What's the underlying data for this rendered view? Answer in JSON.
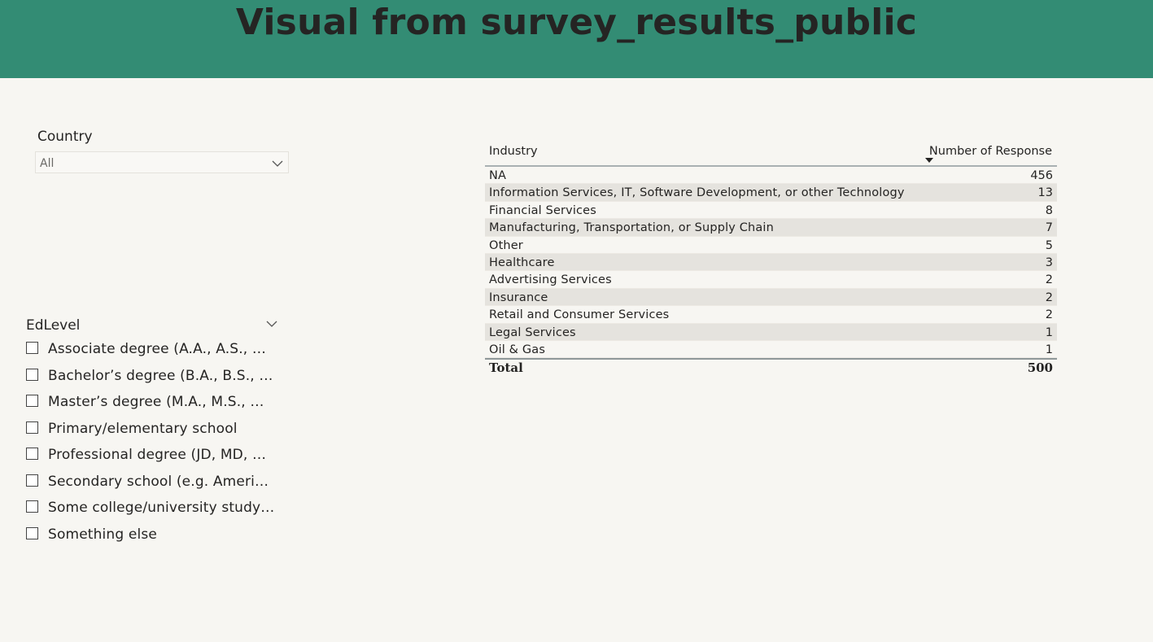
{
  "header": {
    "title": "Visual from survey_results_public",
    "background_color": "#338c74"
  },
  "country_slicer": {
    "title": "Country",
    "selected": "All",
    "chevron_icon": "chevron-down-icon"
  },
  "edlevel_slicer": {
    "title": "EdLevel",
    "chevron_icon": "chevron-down-icon",
    "options": [
      {
        "label": "Associate degree (A.A., A.S., …",
        "checked": false
      },
      {
        "label": "Bachelor’s degree (B.A., B.S., …",
        "checked": false
      },
      {
        "label": "Master’s degree (M.A., M.S., …",
        "checked": false
      },
      {
        "label": "Primary/elementary school",
        "checked": false
      },
      {
        "label": "Professional degree (JD, MD, …",
        "checked": false
      },
      {
        "label": "Secondary school (e.g. Ameri…",
        "checked": false
      },
      {
        "label": "Some college/university study…",
        "checked": false
      },
      {
        "label": "Something else",
        "checked": false
      }
    ]
  },
  "industry_table": {
    "columns": {
      "industry": "Industry",
      "count": "Number of Response"
    },
    "sort_icon": "sort-descending-icon",
    "rows": [
      {
        "industry": "NA",
        "count": "456"
      },
      {
        "industry": "Information Services, IT, Software Development, or other Technology",
        "count": "13"
      },
      {
        "industry": "Financial Services",
        "count": "8"
      },
      {
        "industry": "Manufacturing, Transportation, or Supply Chain",
        "count": "7"
      },
      {
        "industry": "Other",
        "count": "5"
      },
      {
        "industry": "Healthcare",
        "count": "3"
      },
      {
        "industry": "Advertising Services",
        "count": "2"
      },
      {
        "industry": "Insurance",
        "count": "2"
      },
      {
        "industry": "Retail and Consumer Services",
        "count": "2"
      },
      {
        "industry": "Legal Services",
        "count": "1"
      },
      {
        "industry": "Oil & Gas",
        "count": "1"
      }
    ],
    "total": {
      "label": "Total",
      "value": "500"
    }
  }
}
